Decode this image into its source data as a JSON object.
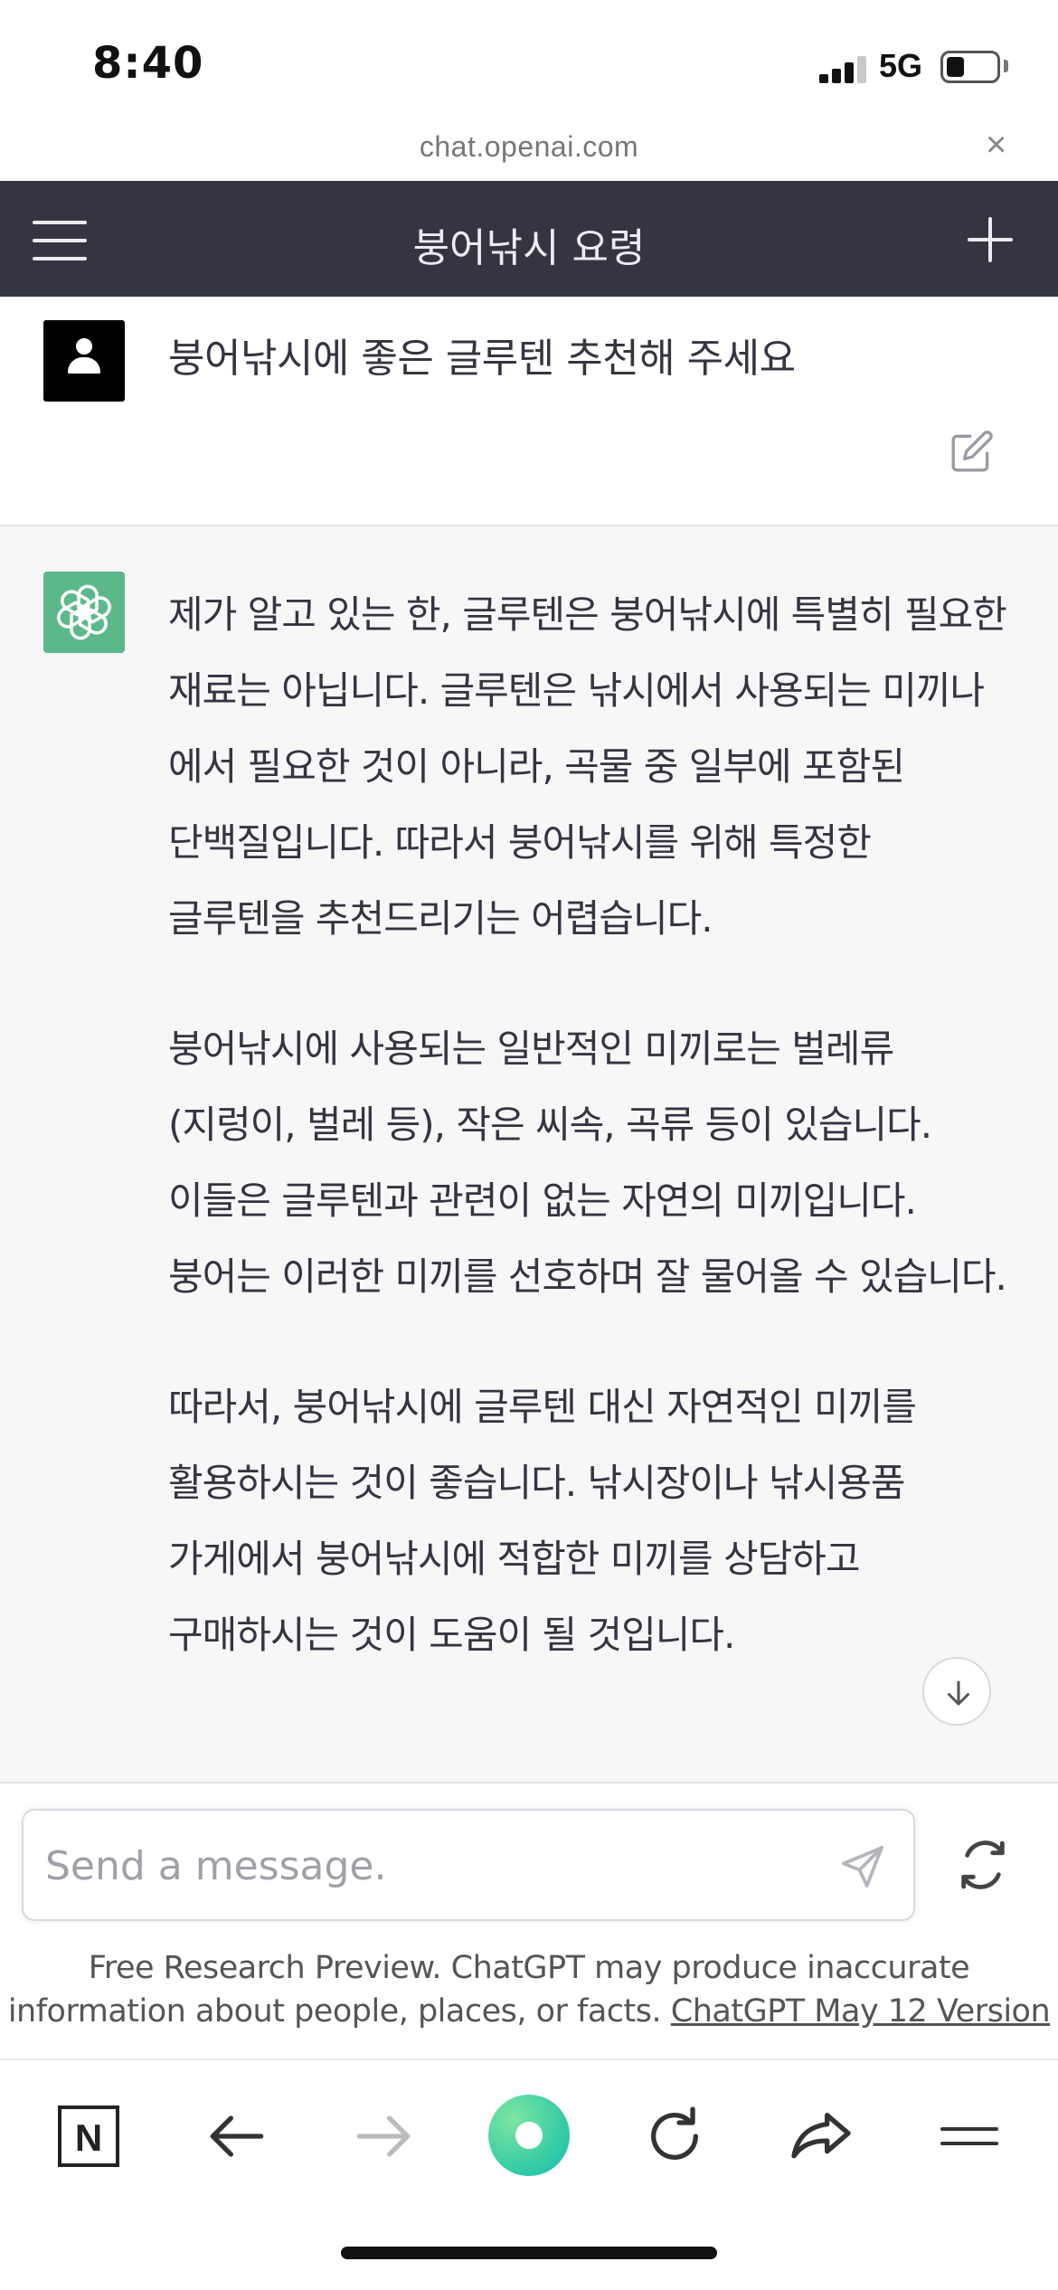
{
  "status_bar": {
    "time": "8:40",
    "network": "5G",
    "battery_level": 0.35
  },
  "browser": {
    "url": "chat.openai.com",
    "close_glyph": "×"
  },
  "header": {
    "title": "붕어낚시 요령",
    "menu_icon": "hamburger-menu-icon",
    "new_chat_icon": "plus-icon"
  },
  "user_message": {
    "text": "붕어낚시에 좋은 글루텐 추천해 주세요",
    "avatar_icon": "user-icon",
    "edit_icon": "edit-icon"
  },
  "assistant_message": {
    "avatar_icon": "openai-logo-icon",
    "paragraphs": [
      "제가 알고 있는 한, 글루텐은 붕어낚시에 특별히 필요한 재료는 아닙니다. 글루텐은 낚시에서 사용되는 미끼나 에서 필요한 것이 아니라, 곡물 중 일부에 포함된 단백질입니다. 따라서 붕어낚시를 위해 특정한 글루텐을 추천드리기는 어렵습니다.",
      "붕어낚시에 사용되는 일반적인 미끼로는 벌레류(지렁이, 벌레 등), 작은 씨속, 곡류 등이 있습니다. 이들은 글루텐과 관련이 없는 자연의 미끼입니다. 붕어는 이러한 미끼를 선호하며 잘 물어올 수 있습니다.",
      "따라서, 붕어낚시에 글루텐 대신 자연적인 미끼를 활용하시는 것이 좋습니다. 낚시장이나 낚시용품 가게에서 붕어낚시에 적합한 미끼를 상담하고 구매하시는 것이 도움이 될 것입니다."
    ]
  },
  "composer": {
    "placeholder": "Send a message.",
    "send_icon": "send-icon",
    "regenerate_icon": "regenerate-icon"
  },
  "disclaimer": {
    "text_line1": "Free Research Preview. ChatGPT may produce inaccurate",
    "text_line2": "information about people, places, or facts.",
    "link": "ChatGPT May 12 Version"
  },
  "browser_toolbar": {
    "icons": [
      "naver-n-icon",
      "back-arrow-icon",
      "forward-arrow-icon",
      "home-dot-icon",
      "reload-icon",
      "share-icon",
      "tabs-menu-icon"
    ]
  },
  "colors": {
    "header_bg": "#343541",
    "assistant_bg": "#f7f7f8",
    "gpt_avatar": "#5cb88a"
  }
}
